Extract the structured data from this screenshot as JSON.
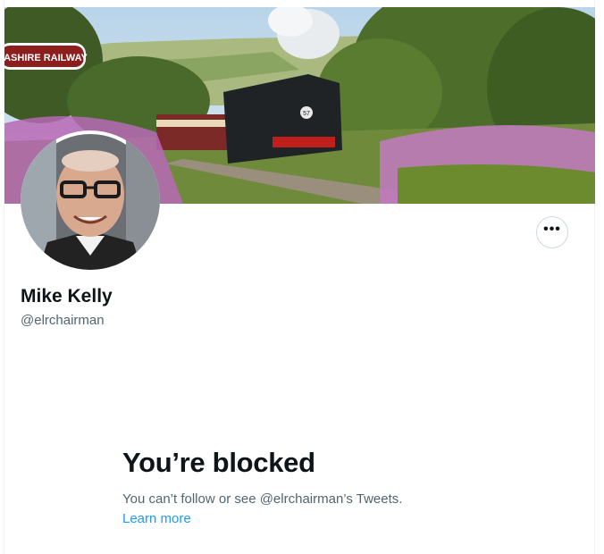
{
  "banner": {
    "sign_text": "CASHIRE RAILWAY",
    "engine_number": "57"
  },
  "profile": {
    "name": "Mike Kelly",
    "handle": "@elrchairman",
    "more_label": "•••"
  },
  "blocked": {
    "title": "You’re blocked",
    "description": "You can’t follow or see @elrchairman’s Tweets.",
    "learn_more": "Learn more"
  },
  "colors": {
    "link": "#1d9bf0",
    "secondary_text": "#536471",
    "primary_text": "#0f1419"
  }
}
